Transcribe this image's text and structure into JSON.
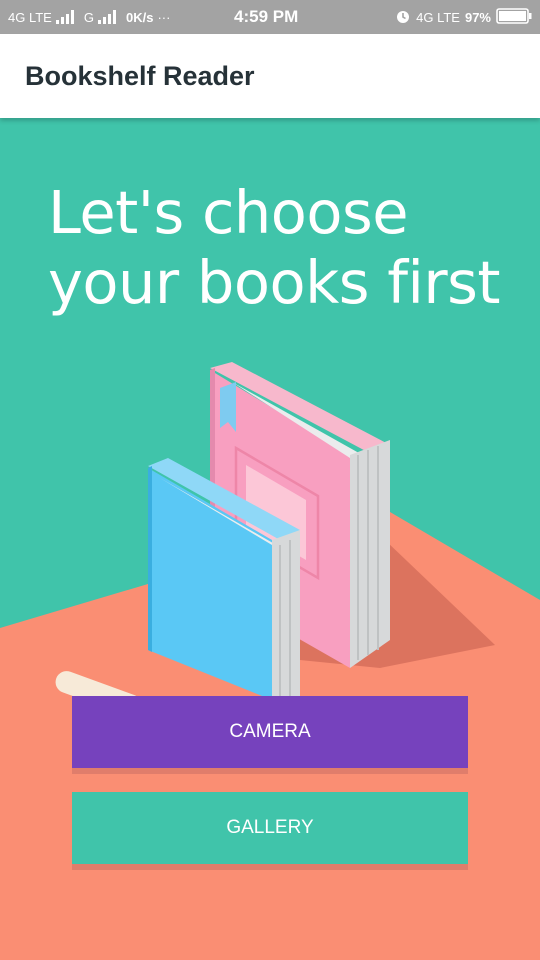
{
  "status_bar": {
    "network_left": "4G LTE",
    "network_mid": "G",
    "speed": "0K/s",
    "more": "···",
    "time": "4:59 PM",
    "network_right": "4G LTE",
    "battery": "97%",
    "icons": [
      "signal-icon",
      "alarm-icon",
      "battery-icon"
    ]
  },
  "app_bar": {
    "title": "Bookshelf Reader"
  },
  "hero": {
    "title_line1": "Let's choose",
    "title_line2": "your books first"
  },
  "buttons": {
    "camera": "CAMERA",
    "gallery": "GALLERY"
  },
  "colors": {
    "teal": "#40c4aa",
    "salmon": "#fa8e73",
    "purple": "#7642bd",
    "status_bar": "#a3a3a3"
  }
}
